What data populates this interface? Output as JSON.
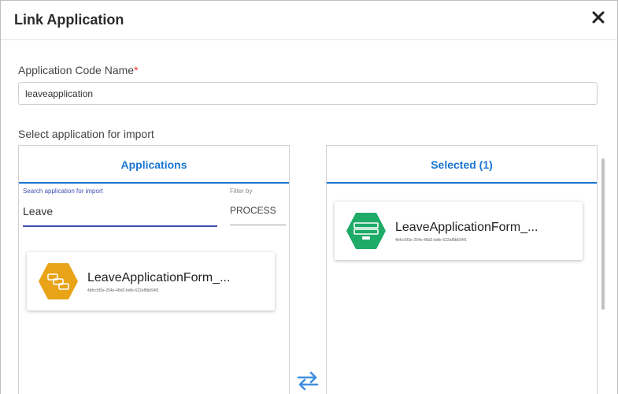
{
  "dialog": {
    "title": "Link Application"
  },
  "form": {
    "code_label": "Application Code Name",
    "required_mark": "*",
    "code_value": "leaveapplication",
    "select_label": "Select application for import"
  },
  "applications_panel": {
    "title": "Applications",
    "search_label": "Search application for import",
    "search_value": "Leave",
    "filter_label": "Filter by",
    "filter_value": "PROCESS",
    "items": [
      {
        "name": "LeaveApplicationForm_...",
        "id": "4bfcc5f3e-254e-48d2-bdfe-622af8b694f1",
        "icon": "process-icon",
        "color": "#e8a317"
      }
    ]
  },
  "selected_panel": {
    "title": "Selected (1)",
    "items": [
      {
        "name": "LeaveApplicationForm_...",
        "id": "4bfcc5f3e-254e-48d2-bdfe-622af8b694f1",
        "icon": "form-icon",
        "color": "#1eaa67"
      }
    ]
  },
  "colors": {
    "accent": "#1976d2",
    "required": "#e53935",
    "process": "#e8a317",
    "form": "#1eaa67"
  }
}
